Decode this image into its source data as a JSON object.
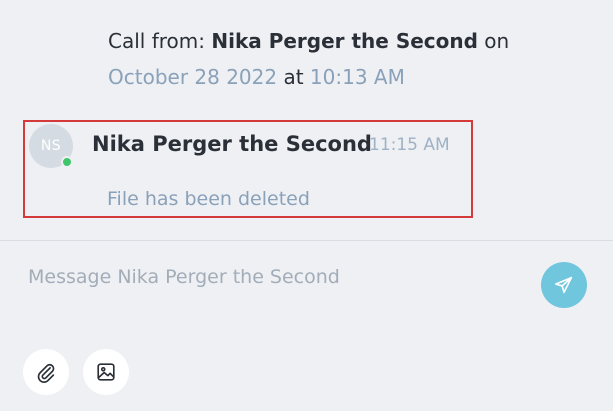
{
  "call_info": {
    "prefix": "Call from: ",
    "caller": "Nika Perger the Second",
    "on_word": " on",
    "date": "October 28 2022",
    "at_word": " at ",
    "time": "10:13 AM"
  },
  "message": {
    "avatar_initials": "NS",
    "sender": "Nika Perger the Second",
    "time": "11:15 AM",
    "text": "File has been deleted",
    "online": true
  },
  "composer": {
    "placeholder": "Message Nika Perger the Second"
  },
  "icons": {
    "send": "send-icon",
    "attach": "paperclip-icon",
    "image": "image-icon"
  },
  "colors": {
    "background": "#eef0f3",
    "accent": "#6fc6dd",
    "online": "#3fc66a",
    "highlight_border": "#d43a3a",
    "muted_text": "#8aa1ba"
  }
}
